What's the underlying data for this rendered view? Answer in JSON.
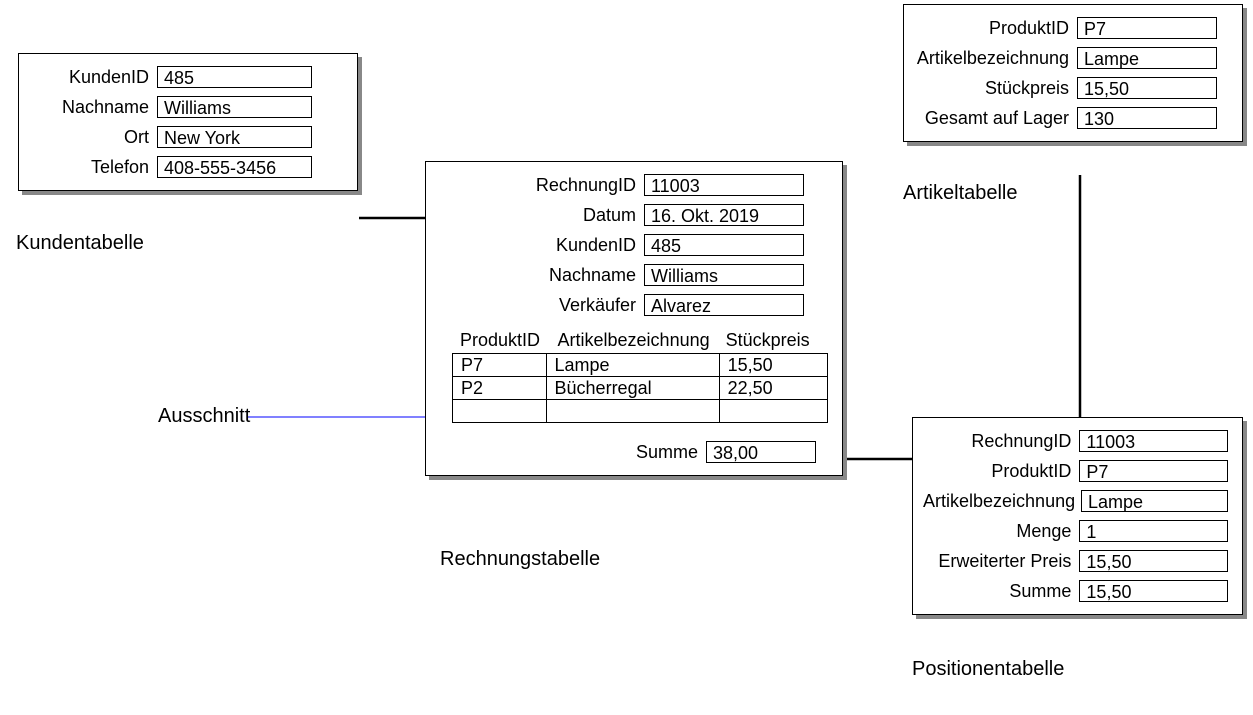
{
  "annotation": {
    "ausschnitt": "Ausschnitt"
  },
  "kunden": {
    "caption": "Kundentabelle",
    "labels": {
      "kundenid": "KundenID",
      "nachname": "Nachname",
      "ort": "Ort",
      "telefon": "Telefon"
    },
    "values": {
      "kundenid": "485",
      "nachname": "Williams",
      "ort": "New York",
      "telefon": "408-555-3456"
    }
  },
  "artikel": {
    "caption": "Artikeltabelle",
    "labels": {
      "produktid": "ProduktID",
      "artbez": "Artikelbezeichnung",
      "stueckpreis": "Stückpreis",
      "lager": "Gesamt auf Lager"
    },
    "values": {
      "produktid": "P7",
      "artbez": "Lampe",
      "stueckpreis": "15,50",
      "lager": "130"
    }
  },
  "rechnung": {
    "caption": "Rechnungstabelle",
    "labels": {
      "rechnungid": "RechnungID",
      "datum": "Datum",
      "kundenid": "KundenID",
      "nachname": "Nachname",
      "verkaeufer": "Verkäufer",
      "summe": "Summe"
    },
    "values": {
      "rechnungid": "11003",
      "datum": "16. Okt. 2019",
      "kundenid": "485",
      "nachname": "Williams",
      "verkaeufer": "Alvarez",
      "summe": "38,00"
    },
    "cols": {
      "produktid": "ProduktID",
      "artbez": "Artikelbezeichnung",
      "stueckpreis": "Stückpreis"
    },
    "lines": [
      {
        "pid": "P7",
        "art": "Lampe",
        "stk": "15,50"
      },
      {
        "pid": "P2",
        "art": "Bücherregal",
        "stk": "22,50"
      },
      {
        "pid": "",
        "art": "",
        "stk": ""
      }
    ]
  },
  "position": {
    "caption": "Positionentabelle",
    "labels": {
      "rechnungid": "RechnungID",
      "produktid": "ProduktID",
      "artbez": "Artikelbezeichnung",
      "menge": "Menge",
      "erwpreis": "Erweiterter Preis",
      "summe": "Summe"
    },
    "values": {
      "rechnungid": "11003",
      "produktid": "P7",
      "artbez": "Lampe",
      "menge": "1",
      "erwpreis": "15,50",
      "summe": "15,50"
    }
  }
}
